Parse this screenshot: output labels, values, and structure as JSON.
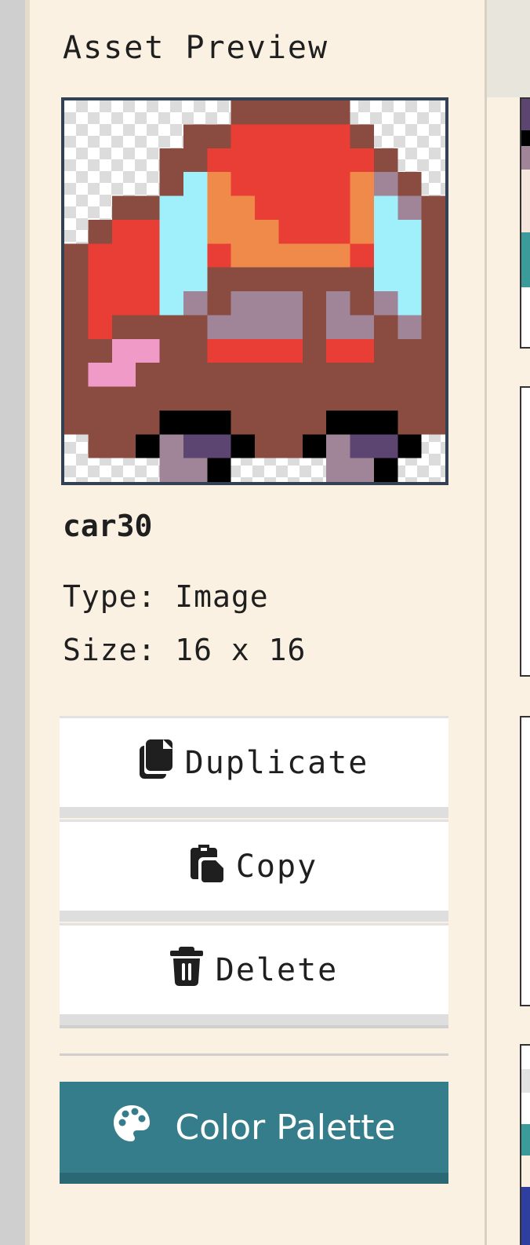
{
  "panel": {
    "title": "Asset Preview",
    "asset_name": "car30",
    "type_line": "Type: Image",
    "size_line": "Size: 16 x 16"
  },
  "actions": {
    "duplicate_label": "Duplicate",
    "copy_label": "Copy",
    "delete_label": "Delete",
    "palette_label": "Color Palette"
  },
  "icons": {
    "duplicate": "duplicate-icon",
    "copy": "clipboard-icon",
    "delete": "trash-icon",
    "palette": "palette-icon"
  },
  "colors": {
    "background": "#fbf1e2",
    "preview_border": "#334155",
    "palette_button": "#357d8a"
  }
}
